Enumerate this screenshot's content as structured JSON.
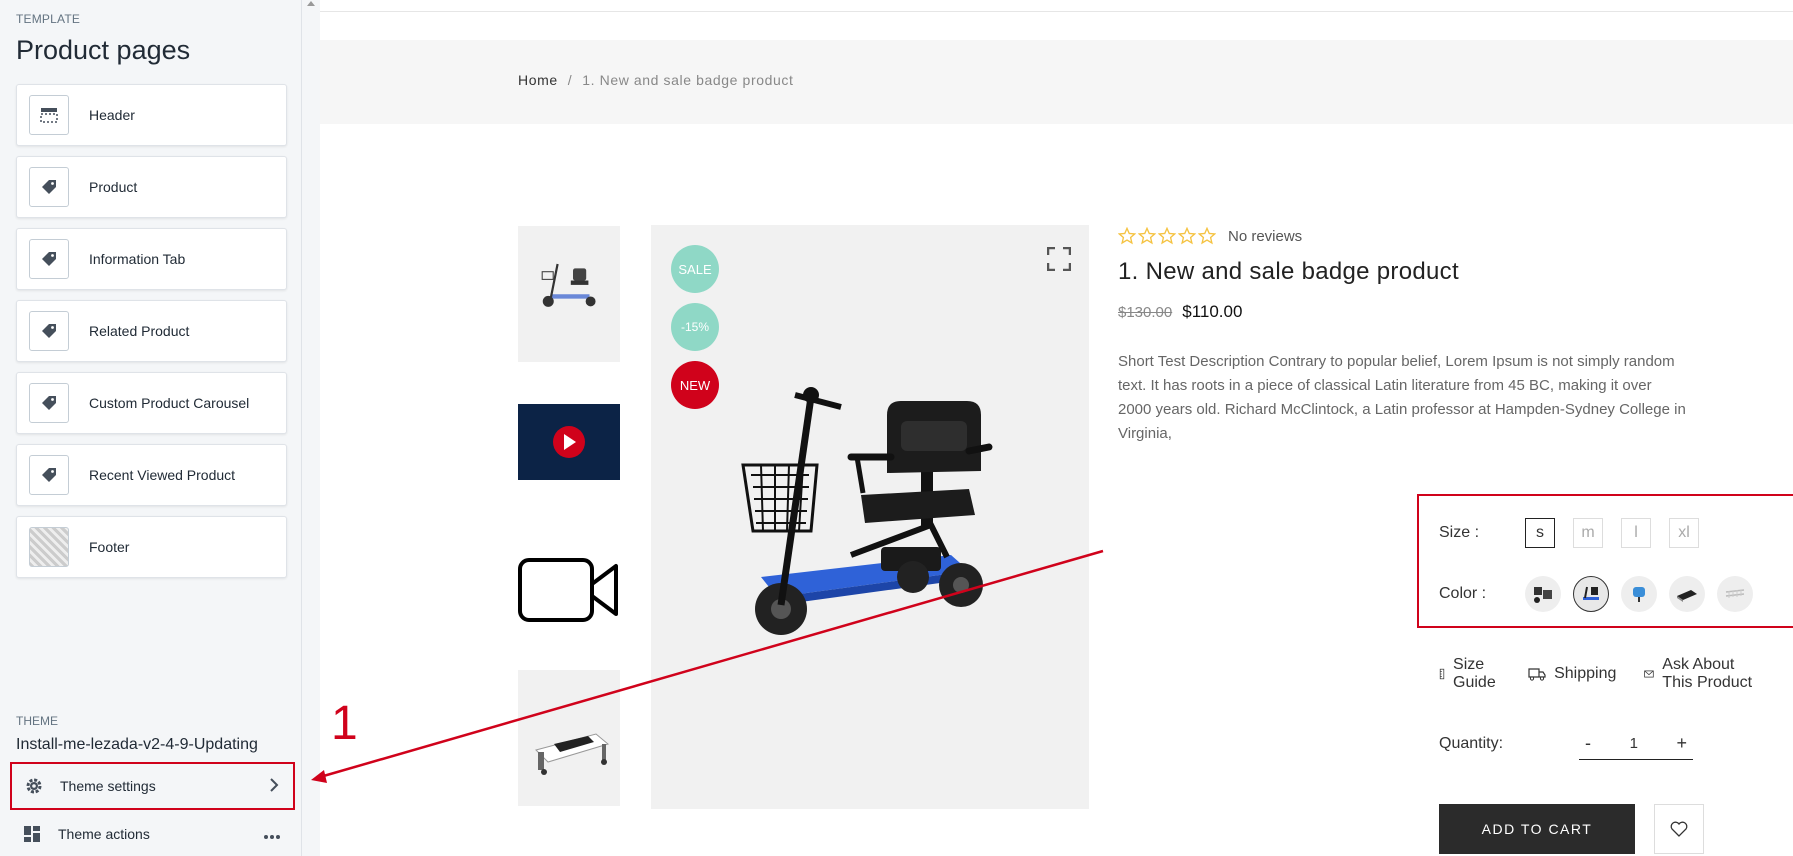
{
  "sidebar": {
    "template_label": "TEMPLATE",
    "title": "Product pages",
    "sections": [
      {
        "label": "Header",
        "icon": "header-layout-icon"
      },
      {
        "label": "Product",
        "icon": "tag-icon"
      },
      {
        "label": "Information Tab",
        "icon": "tag-icon"
      },
      {
        "label": "Related Product",
        "icon": "tag-icon"
      },
      {
        "label": "Custom Product Carousel",
        "icon": "tag-icon"
      },
      {
        "label": "Recent Viewed Product",
        "icon": "tag-icon"
      },
      {
        "label": "Footer",
        "icon": "footer-thumbnail"
      }
    ],
    "theme_label": "THEME",
    "theme_name": "Install-me-lezada-v2-4-9-Updating",
    "theme_settings": "Theme settings",
    "theme_actions": "Theme actions"
  },
  "store": {
    "breadcrumb": {
      "home": "Home",
      "separator": "/",
      "current": "1. New and sale badge product"
    },
    "badges": {
      "sale": "SALE",
      "discount": "-15%",
      "new": "NEW"
    },
    "rating": {
      "stars_filled": 0,
      "stars_total": 5,
      "text": "No reviews"
    },
    "product_title": "1. New and sale badge product",
    "price_old": "$130.00",
    "price_new": "$110.00",
    "description": "Short Test Description Contrary to popular belief, Lorem Ipsum is not simply random text. It has roots in a piece of classical Latin literature from 45 BC, making it over 2000 years old. Richard McClintock, a Latin professor at Hampden-Sydney College in Virginia,",
    "size_label": "Size :",
    "sizes": [
      "s",
      "m",
      "l",
      "xl"
    ],
    "selected_size": "s",
    "color_label": "Color :",
    "links": {
      "size_guide": "Size Guide",
      "shipping": "Shipping",
      "ask": "Ask About This Product"
    },
    "quantity_label": "Quantity:",
    "quantity_minus": "-",
    "quantity_value": "1",
    "quantity_plus": "+",
    "add_to_cart": "ADD TO CART"
  },
  "annotation": {
    "number": "1",
    "color": "#d0021b"
  },
  "colors": {
    "accent_red": "#d0021b",
    "badge_teal": "#8fd8c6",
    "button_dark": "#2b2b2b",
    "star": "#f5c342"
  }
}
